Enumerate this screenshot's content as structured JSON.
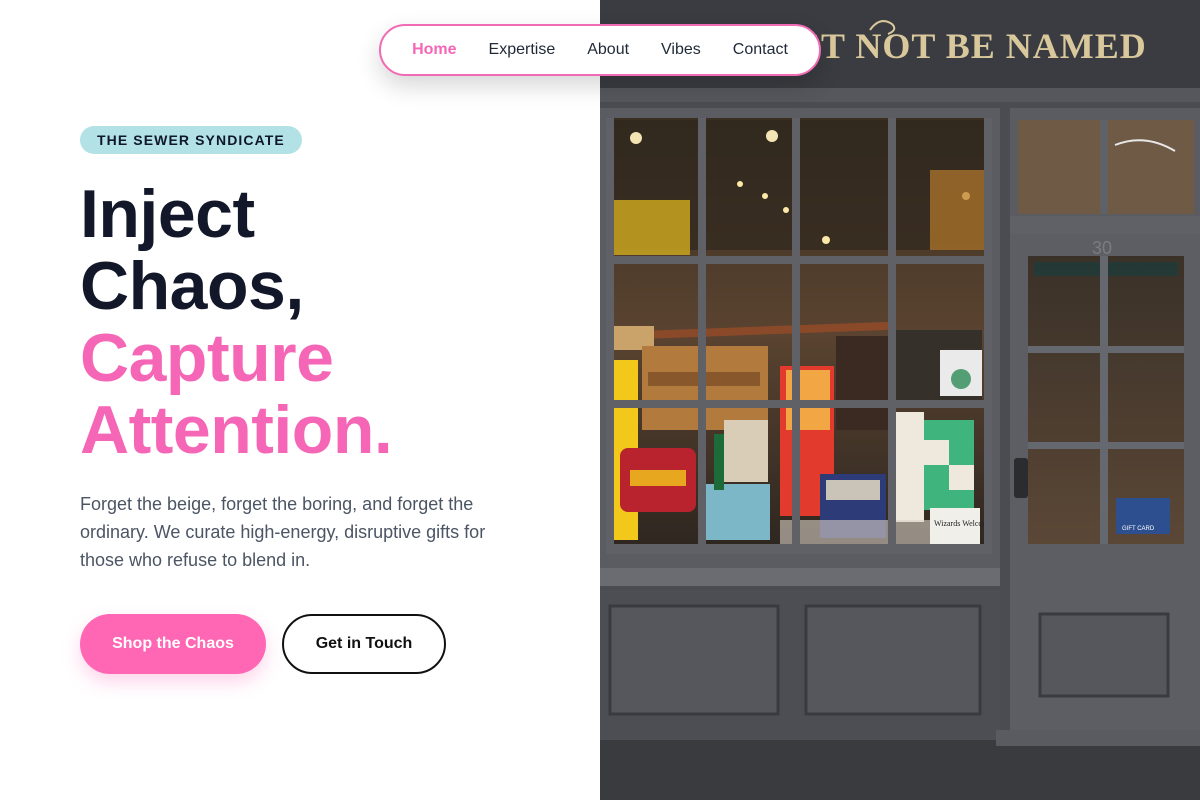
{
  "nav": {
    "items": [
      {
        "label": "Home",
        "active": true
      },
      {
        "label": "Expertise",
        "active": false
      },
      {
        "label": "About",
        "active": false
      },
      {
        "label": "Vibes",
        "active": false
      },
      {
        "label": "Contact",
        "active": false
      }
    ]
  },
  "hero": {
    "badge": "THE SEWER SYNDICATE",
    "headline": {
      "line1": "Inject",
      "line2": "Chaos,",
      "line3": "Capture",
      "line4": "Attention."
    },
    "description": "Forget the beige, forget the boring, and forget the ordinary. We curate high-energy, disruptive gifts for those who refuse to blend in.",
    "primary_cta": "Shop the Chaos",
    "secondary_cta": "Get in Touch"
  },
  "storefront": {
    "sign_text": "ST NOT BE NAMED",
    "door_number": "30",
    "window_signs": [
      "Wizards Welcome",
      "GIFT CARD"
    ]
  },
  "colors": {
    "accent_pink": "#f566b7",
    "badge_teal": "#b3e2e6",
    "headline_dark": "#121829",
    "body_text": "#4b5563"
  }
}
